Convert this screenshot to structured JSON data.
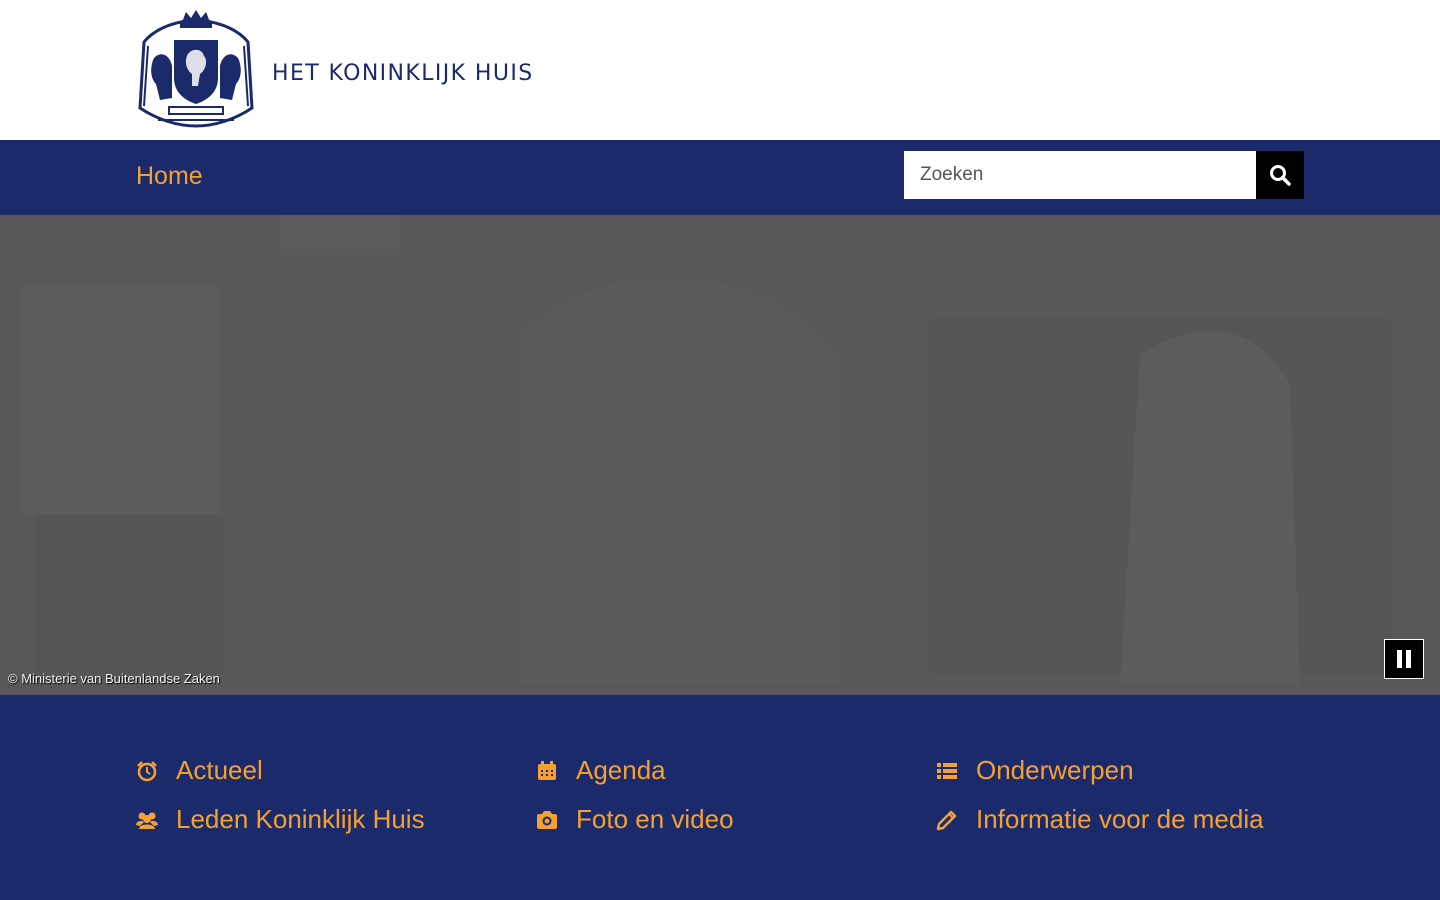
{
  "header": {
    "site_title": "HET KONINKLIJK HUIS",
    "crest_icon": "royal-crest-icon"
  },
  "nav": {
    "home_label": "Home",
    "search_placeholder": "Zoeken",
    "search_icon": "search-icon"
  },
  "hero": {
    "credit": "© Ministerie van Buitenlandse Zaken",
    "pause_icon": "pause-icon"
  },
  "quick_links": [
    {
      "label": "Actueel",
      "icon": "alarm-clock-icon"
    },
    {
      "label": "Agenda",
      "icon": "calendar-icon"
    },
    {
      "label": "Onderwerpen",
      "icon": "list-icon"
    },
    {
      "label": "Leden Koninklijk Huis",
      "icon": "users-icon"
    },
    {
      "label": "Foto en video",
      "icon": "camera-icon"
    },
    {
      "label": "Informatie voor de media",
      "icon": "pencil-icon"
    }
  ],
  "colors": {
    "brand_blue": "#1b2a6b",
    "accent_orange": "#f5a132",
    "hero_grey": "#575857"
  }
}
